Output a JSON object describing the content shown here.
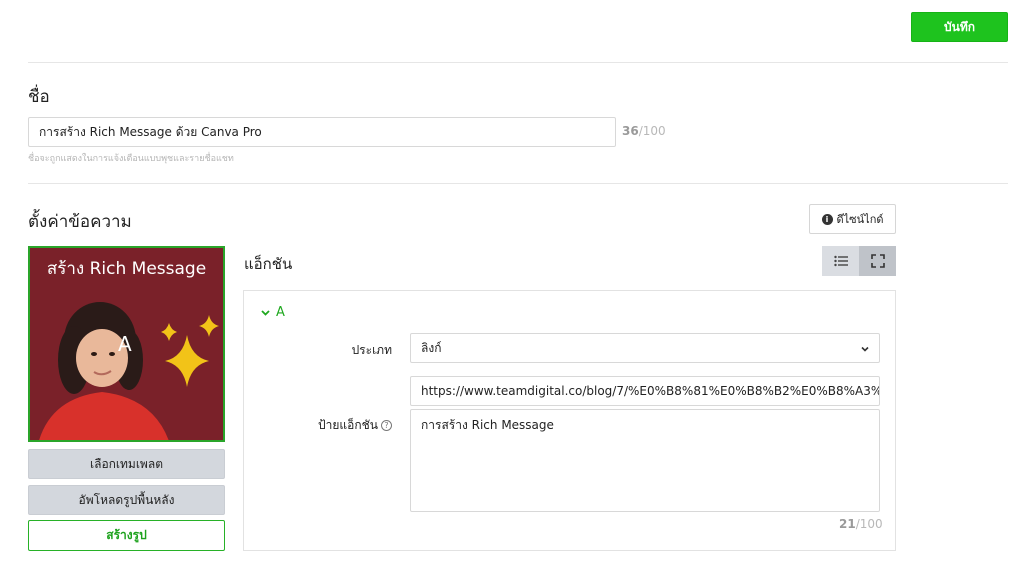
{
  "header": {
    "save_label": "บันทึก"
  },
  "name_section": {
    "title": "ชื่อ",
    "value": "การสร้าง Rich Message ด้วย Canva Pro",
    "count": "36",
    "max": "/100",
    "hint": "ชื่อจะถูกแสดงในการแจ้งเตือนแบบพุชและรายชื่อแชท"
  },
  "message_section": {
    "title": "ตั้งค่าข้อความ",
    "guide_label": "ดีไซน์ไกด์",
    "preview": {
      "title": "สร้าง Rich Message",
      "area_letter": "A"
    },
    "buttons": {
      "select_template": "เลือกเทมเพลต",
      "upload_background": "อัพโหลดรูปพื้นหลัง",
      "create_image": "สร้างรูป"
    }
  },
  "action": {
    "heading": "แอ็กชัน",
    "area": "A",
    "type_label": "ประเภท",
    "type_value": "ลิงก์",
    "url": "https://www.teamdigital.co/blog/7/%E0%B8%81%E0%B8%B2%E0%B8%A3%E0%B8",
    "action_label": "ป้ายแอ็กชัน",
    "action_label_value": "การสร้าง Rich Message",
    "count": "21",
    "max": "/100"
  },
  "colors": {
    "accent": "#1ec31e",
    "preview_bg": "#7a2129",
    "sparkle": "#f2c318"
  }
}
